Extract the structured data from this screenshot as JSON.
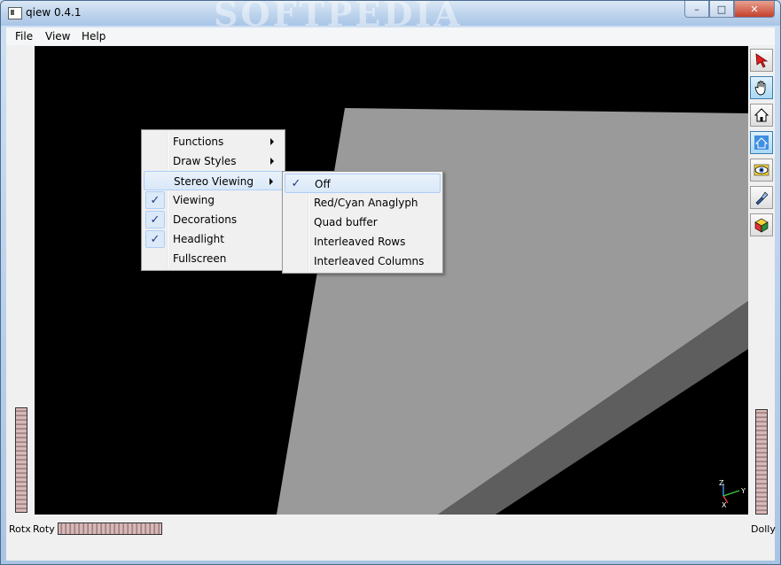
{
  "window": {
    "title": "qiew 0.4.1",
    "watermark": "SOFTPEDIA"
  },
  "caption_buttons": {
    "minimize": "–",
    "maximize": "□",
    "close": "✕"
  },
  "menubar": {
    "items": [
      "File",
      "View",
      "Help"
    ]
  },
  "view_menu": {
    "items": [
      {
        "label": "Functions",
        "submenu": true,
        "checked": false
      },
      {
        "label": "Draw Styles",
        "submenu": true,
        "checked": false
      },
      {
        "label": "Stereo Viewing",
        "submenu": true,
        "checked": false,
        "highlighted": true
      },
      {
        "label": "Viewing",
        "submenu": false,
        "checked": true
      },
      {
        "label": "Decorations",
        "submenu": false,
        "checked": true
      },
      {
        "label": "Headlight",
        "submenu": false,
        "checked": true
      },
      {
        "label": "Fullscreen",
        "submenu": false,
        "checked": false
      }
    ]
  },
  "stereo_submenu": {
    "items": [
      {
        "label": "Off",
        "checked": true,
        "highlighted": true
      },
      {
        "label": "Red/Cyan Anaglyph",
        "checked": false
      },
      {
        "label": "Quad buffer",
        "checked": false
      },
      {
        "label": "Interleaved Rows",
        "checked": false
      },
      {
        "label": "Interleaved Columns",
        "checked": false
      }
    ]
  },
  "bottom": {
    "rotx_label": "Rotx",
    "roty_label": "Roty",
    "dolly_label": "Dolly"
  },
  "axes": {
    "x": "X",
    "y": "Y",
    "z": "Z"
  },
  "toolbar": {
    "icons": [
      "select-arrow-icon",
      "hand-icon",
      "home-icon",
      "set-home-icon",
      "view-all-eye-icon",
      "seek-flashlight-icon",
      "projection-cube-icon"
    ]
  },
  "colors": {
    "viewport_bg": "#000000",
    "face_light": "#9a9a9a",
    "face_dark": "#5e5e5e",
    "accent": "#1e3a86"
  }
}
